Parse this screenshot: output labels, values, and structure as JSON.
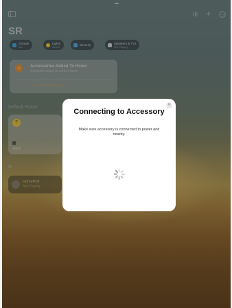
{
  "home": {
    "title": "SR",
    "chips": [
      {
        "label": "Climate",
        "sub": "Idle",
        "color": "#4aa3d8"
      },
      {
        "label": "Lights",
        "sub": "All Off",
        "color": "#f0c63a"
      },
      {
        "label": "Security",
        "sub": "",
        "color": "#5aa8e0"
      },
      {
        "label": "Speakers & TVs",
        "sub": "Not Playing",
        "color": "#cfd3d6"
      }
    ],
    "notice": {
      "title": "Accessories Added To Home",
      "subtitle": "Complete setup to control them",
      "action": "Set Up Accessories"
    },
    "section_default": "Default Room",
    "tile_label": "Apple",
    "section_rooms": "R",
    "homepod": {
      "name": "HomePod",
      "status": "Not Playing"
    }
  },
  "modal": {
    "title": "Connecting to Accessory",
    "message": "Make sure accessory is connected to power and nearby.",
    "close_icon": "close-icon",
    "spinner_icon": "spinner-icon"
  },
  "colors": {
    "modal_bg": "#ffffff",
    "accent_orange": "#f08c28"
  }
}
